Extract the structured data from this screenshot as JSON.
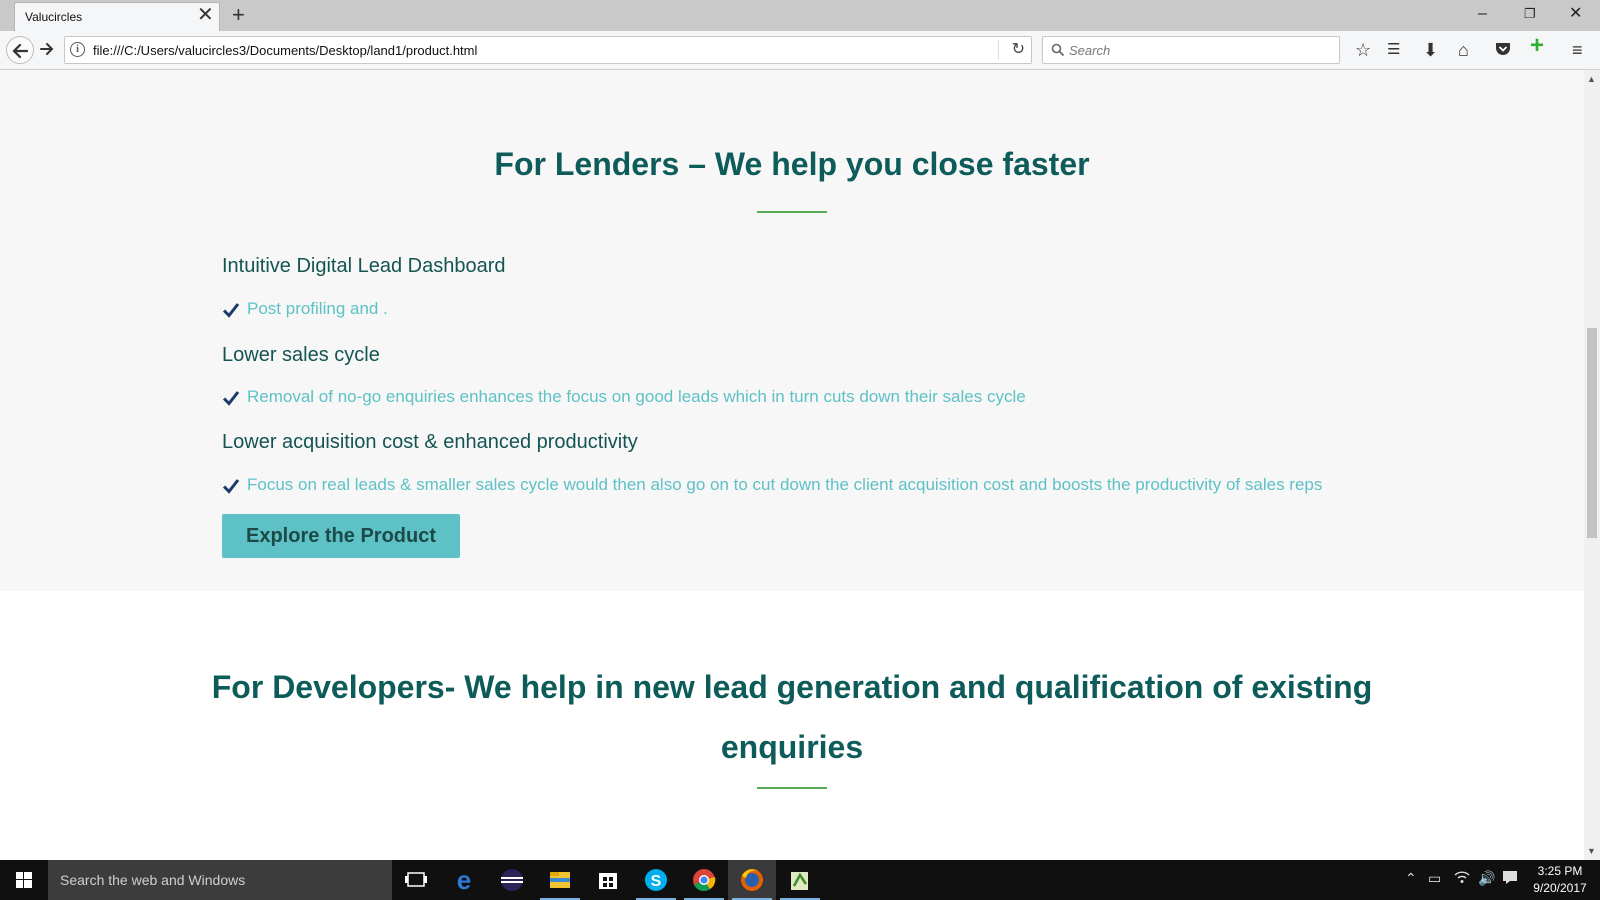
{
  "browser": {
    "tab_title": "Valucircles",
    "url": "file:///C:/Users/valucircles3/Documents/Desktop/land1/product.html",
    "search_placeholder": "Search"
  },
  "section_lenders": {
    "title": "For Lenders – We help you close faster",
    "features": [
      {
        "heading": "Intuitive Digital Lead Dashboard",
        "point": "Post profiling and ."
      },
      {
        "heading": "Lower sales cycle",
        "point": "Removal of no-go enquiries enhances the focus on good leads which in turn cuts down their sales cycle"
      },
      {
        "heading": "Lower acquisition cost & enhanced productivity",
        "point": "Focus on real leads & smaller sales cycle would then also go on to cut down the client acquisition cost and boosts the productivity of sales reps"
      }
    ],
    "button_label": "Explore the Product"
  },
  "section_developers": {
    "title_line1": "For Developers- We help in new lead generation and qualification of existing",
    "title_line2": "enquiries"
  },
  "taskbar": {
    "search_text": "Search the web and Windows",
    "time": "3:25 PM",
    "date": "9/20/2017"
  },
  "colors": {
    "heading": "#0e5c5a",
    "accent": "#5ec1c6",
    "underline": "#5aab55",
    "check": "#1d3a6b"
  }
}
